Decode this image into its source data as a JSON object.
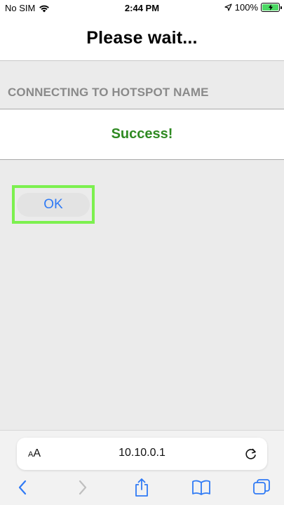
{
  "status_bar": {
    "carrier": "No SIM",
    "time": "2:44 PM",
    "battery_percent": "100%",
    "battery_level": 1.0
  },
  "header": {
    "title": "Please wait..."
  },
  "section": {
    "label": "CONNECTING TO HOTSPOT NAME"
  },
  "result": {
    "message": "Success!",
    "color": "#2f8a22"
  },
  "ok_button": {
    "label": "OK",
    "highlight_color": "#7cf04f",
    "text_color": "#2f7af5"
  },
  "browser": {
    "aa_label_small": "A",
    "aa_label_large": "A",
    "url": "10.10.0.1"
  },
  "toolbar": {
    "icons": [
      "back-icon",
      "forward-icon",
      "share-icon",
      "bookmarks-icon",
      "tabs-icon"
    ]
  }
}
